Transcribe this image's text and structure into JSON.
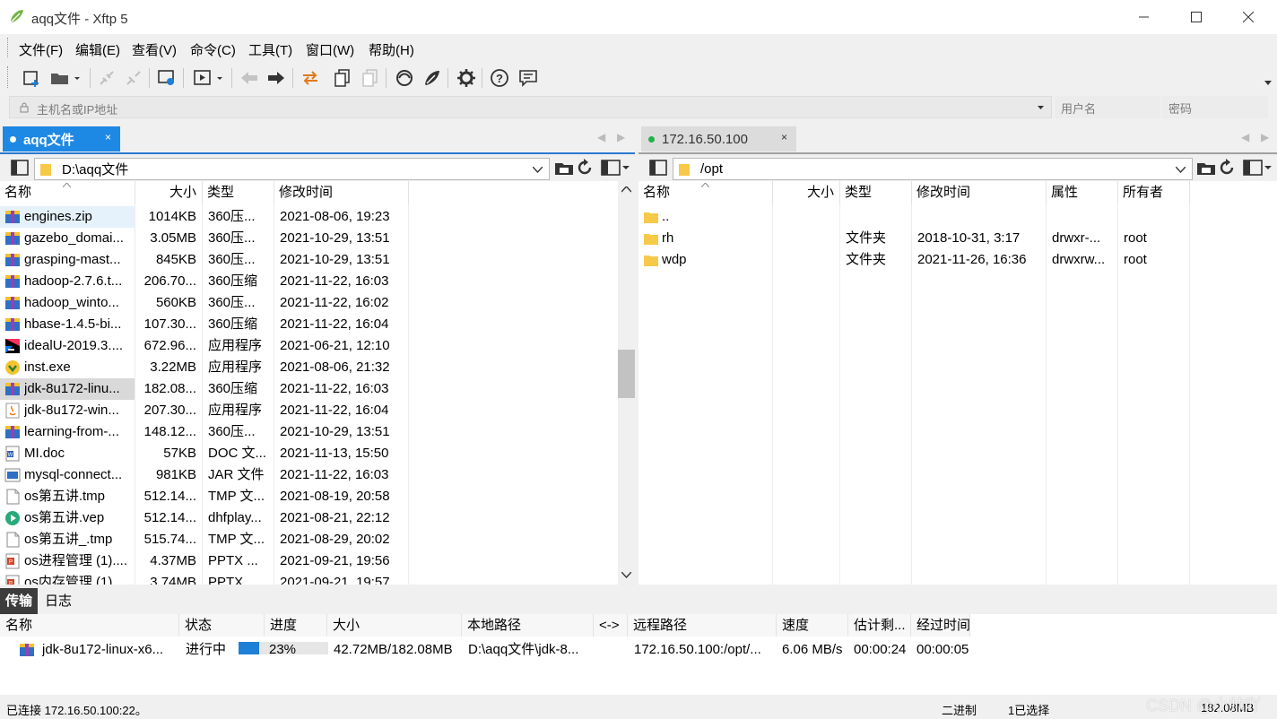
{
  "window": {
    "title": "aqq文件 - Xftp 5"
  },
  "menu": [
    "文件(F)",
    "编辑(E)",
    "查看(V)",
    "命令(C)",
    "工具(T)",
    "窗口(W)",
    "帮助(H)"
  ],
  "address": {
    "host_placeholder": "主机名或IP地址",
    "user_placeholder": "用户名",
    "password_placeholder": "密码"
  },
  "left_pane": {
    "tab_label": "aqq文件",
    "path": "D:\\aqq文件",
    "columns": [
      "名称",
      "大小",
      "类型",
      "修改时间"
    ],
    "rows": [
      {
        "name": "engines.zip",
        "size": "1014KB",
        "type": "360压...",
        "mtime": "2021-08-06, 19:23",
        "icon": "archive-icon"
      },
      {
        "name": "gazebo_domai...",
        "size": "3.05MB",
        "type": "360压...",
        "mtime": "2021-10-29, 13:51",
        "icon": "archive-icon"
      },
      {
        "name": "grasping-mast...",
        "size": "845KB",
        "type": "360压...",
        "mtime": "2021-10-29, 13:51",
        "icon": "archive-icon"
      },
      {
        "name": "hadoop-2.7.6.t...",
        "size": "206.70...",
        "type": "360压缩",
        "mtime": "2021-11-22, 16:03",
        "icon": "archive-icon"
      },
      {
        "name": "hadoop_winto...",
        "size": "560KB",
        "type": "360压...",
        "mtime": "2021-11-22, 16:02",
        "icon": "archive-icon"
      },
      {
        "name": "hbase-1.4.5-bi...",
        "size": "107.30...",
        "type": "360压缩",
        "mtime": "2021-11-22, 16:04",
        "icon": "archive-icon"
      },
      {
        "name": "idealU-2019.3....",
        "size": "672.96...",
        "type": "应用程序",
        "mtime": "2021-06-21, 12:10",
        "icon": "idea-app-icon"
      },
      {
        "name": "inst.exe",
        "size": "3.22MB",
        "type": "应用程序",
        "mtime": "2021-08-06, 21:32",
        "icon": "installer-icon"
      },
      {
        "name": "jdk-8u172-linu...",
        "size": "182.08...",
        "type": "360压缩",
        "mtime": "2021-11-22, 16:03",
        "icon": "archive-icon"
      },
      {
        "name": "jdk-8u172-win...",
        "size": "207.30...",
        "type": "应用程序",
        "mtime": "2021-11-22, 16:04",
        "icon": "java-icon"
      },
      {
        "name": "learning-from-...",
        "size": "148.12...",
        "type": "360压...",
        "mtime": "2021-10-29, 13:51",
        "icon": "archive-icon"
      },
      {
        "name": "MI.doc",
        "size": "57KB",
        "type": "DOC 文...",
        "mtime": "2021-11-13, 15:50",
        "icon": "doc-icon"
      },
      {
        "name": "mysql-connect...",
        "size": "981KB",
        "type": "JAR 文件",
        "mtime": "2021-11-22, 16:03",
        "icon": "jar-icon"
      },
      {
        "name": "os第五讲.tmp",
        "size": "512.14...",
        "type": "TMP 文...",
        "mtime": "2021-08-19, 20:58",
        "icon": "file-icon"
      },
      {
        "name": "os第五讲.vep",
        "size": "512.14...",
        "type": "dhfplay...",
        "mtime": "2021-08-21, 22:12",
        "icon": "player-icon"
      },
      {
        "name": "os第五讲_.tmp",
        "size": "515.74...",
        "type": "TMP 文...",
        "mtime": "2021-08-29, 20:02",
        "icon": "file-icon"
      },
      {
        "name": "os进程管理 (1)....",
        "size": "4.37MB",
        "type": "PPTX ...",
        "mtime": "2021-09-21, 19:56",
        "icon": "pptx-icon"
      },
      {
        "name": "os内存管理 (1)...",
        "size": "3.74MB",
        "type": "PPTX ...",
        "mtime": "2021-09-21, 19:57",
        "icon": "pptx-icon"
      }
    ]
  },
  "right_pane": {
    "tab_label": "172.16.50.100",
    "path": "/opt",
    "columns": [
      "名称",
      "大小",
      "类型",
      "修改时间",
      "属性",
      "所有者"
    ],
    "rows": [
      {
        "name": "..",
        "size": "",
        "type": "",
        "mtime": "",
        "attr": "",
        "owner": ""
      },
      {
        "name": "rh",
        "size": "",
        "type": "文件夹",
        "mtime": "2018-10-31, 3:17",
        "attr": "drwxr-...",
        "owner": "root"
      },
      {
        "name": "wdp",
        "size": "",
        "type": "文件夹",
        "mtime": "2021-11-26, 16:36",
        "attr": "drwxrw...",
        "owner": "root"
      }
    ]
  },
  "transfer": {
    "tabs": [
      "传输",
      "日志"
    ],
    "columns": [
      "名称",
      "状态",
      "进度",
      "大小",
      "本地路径",
      "<->",
      "远程路径",
      "速度",
      "估计剩...",
      "经过时间"
    ],
    "items": [
      {
        "name": "jdk-8u172-linux-x6...",
        "status": "进行中",
        "progress_text": "23%",
        "progress": 0.23,
        "size": "42.72MB/182.08MB",
        "local": "D:\\aqq文件\\jdk-8...",
        "dir": "",
        "remote": "172.16.50.100:/opt/...",
        "speed": "6.06 MB/s",
        "eta": "00:00:24",
        "elapsed": "00:00:05"
      }
    ]
  },
  "status": {
    "connection": "已连接 172.16.50.100:22。",
    "mode": "二进制",
    "selection": "1已选择",
    "size": "182.08MB"
  },
  "watermark": "CSDN @小帅吖",
  "colors": {
    "accent": "#2b79d1",
    "tab_active": "#1e88e5",
    "progress": "#1e7fd6",
    "connected": "#27b04a"
  }
}
